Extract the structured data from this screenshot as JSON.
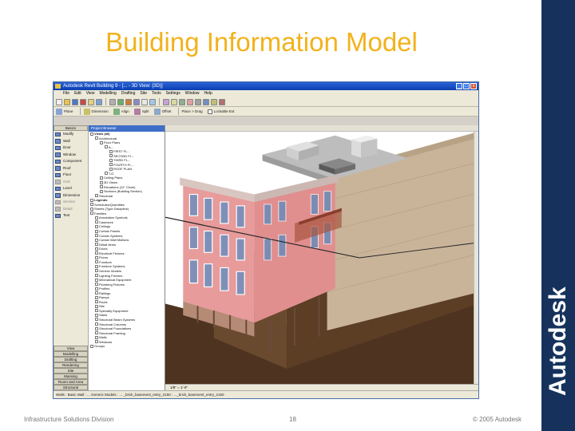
{
  "slide": {
    "title": "Building Information Model",
    "brand": "Autodesk",
    "footer_left": "Infrastructure Solutions Division",
    "footer_center": "18",
    "footer_right": "© 2005 Autodesk"
  },
  "window": {
    "title": "Autodesk Revit Building 9 - [... - 3D View: {3D}]",
    "min_label": "_",
    "max_label": "□",
    "close_label": "x"
  },
  "menu": [
    "File",
    "Edit",
    "View",
    "Modelling",
    "Drafting",
    "Site",
    "Tools",
    "Settings",
    "Window",
    "Help"
  ],
  "toolbar2": {
    "plane_label": "Plane",
    "dimension_label": "Dimension",
    "align_label": "Align",
    "split_label": "Split",
    "offset_label": "Offset",
    "place_label": "Place > Drag",
    "lockable_label": "Lockable Ext"
  },
  "design_bar": {
    "top_tab": "Basics",
    "items": [
      "Modify",
      "Wall",
      "Door",
      "Window",
      "Component",
      "Roof",
      "Floor",
      "Grid",
      "Level",
      "Dimension",
      "Section",
      "Detail",
      "Text"
    ],
    "dim_items": [
      false,
      false,
      false,
      false,
      false,
      false,
      false,
      true,
      false,
      false,
      true,
      true,
      false
    ],
    "bottom_tabs": [
      "View",
      "Modelling",
      "Drafting",
      "Rendering",
      "Site",
      "Massing",
      "Room and Area",
      "Structural"
    ]
  },
  "browser": {
    "title": "Project Browser",
    "items": [
      {
        "t": "Views (all)",
        "d": 0,
        "b": true
      },
      {
        "t": "Architectural",
        "d": 1
      },
      {
        "t": "Floor Plans",
        "d": 2
      },
      {
        "t": "A...",
        "d": 3
      },
      {
        "t": "FIRST FL...",
        "d": 4
      },
      {
        "t": "SECOND FL...",
        "d": 4
      },
      {
        "t": "THIRD FL...",
        "d": 4
      },
      {
        "t": "FOURTH FL...",
        "d": 4
      },
      {
        "t": "ROOF PLAN",
        "d": 4
      },
      {
        "t": "T.O.",
        "d": 3
      },
      {
        "t": "Ceiling Plans",
        "d": 2
      },
      {
        "t": "3D Views",
        "d": 2
      },
      {
        "t": "Elevations (12\" Circle)",
        "d": 2
      },
      {
        "t": "Sections (Building Section)",
        "d": 2
      },
      {
        "t": "Structural",
        "d": 1
      },
      {
        "t": "Legends",
        "d": 0,
        "b": true
      },
      {
        "t": "Schedules/Quantities",
        "d": 0
      },
      {
        "t": "Sheets (Type Discipline)",
        "d": 0
      },
      {
        "t": "Families",
        "d": 0
      },
      {
        "t": "Annotation Symbols",
        "d": 1
      },
      {
        "t": "Casework",
        "d": 1
      },
      {
        "t": "Ceilings",
        "d": 1
      },
      {
        "t": "Curtain Panels",
        "d": 1
      },
      {
        "t": "Curtain Systems",
        "d": 1
      },
      {
        "t": "Curtain Wall Mullions",
        "d": 1
      },
      {
        "t": "Detail Items",
        "d": 1
      },
      {
        "t": "Doors",
        "d": 1
      },
      {
        "t": "Electrical Fixtures",
        "d": 1
      },
      {
        "t": "Floors",
        "d": 1
      },
      {
        "t": "Furniture",
        "d": 1
      },
      {
        "t": "Furniture Systems",
        "d": 1
      },
      {
        "t": "Generic Models",
        "d": 1
      },
      {
        "t": "Lighting Fixtures",
        "d": 1
      },
      {
        "t": "Mechanical Equipment",
        "d": 1
      },
      {
        "t": "Plumbing Fixtures",
        "d": 1
      },
      {
        "t": "Profiles",
        "d": 1
      },
      {
        "t": "Railings",
        "d": 1
      },
      {
        "t": "Ramps",
        "d": 1
      },
      {
        "t": "Roofs",
        "d": 1
      },
      {
        "t": "Site",
        "d": 1
      },
      {
        "t": "Specialty Equipment",
        "d": 1
      },
      {
        "t": "Stairs",
        "d": 1
      },
      {
        "t": "Structural Beam Systems",
        "d": 1
      },
      {
        "t": "Structural Columns",
        "d": 1
      },
      {
        "t": "Structural Foundations",
        "d": 1
      },
      {
        "t": "Structural Framing",
        "d": 1
      },
      {
        "t": "Walls",
        "d": 1
      },
      {
        "t": "Windows",
        "d": 1
      },
      {
        "t": "Groups",
        "d": 0
      }
    ]
  },
  "view": {
    "scale_label": "1/8\" = 1'-0\""
  },
  "status": {
    "text": "Walls : Basic Wall : ... Generic Models : ... _brick_basement_entry_2150 : ..._brick_basement_entry_2150"
  },
  "colors": {
    "title": "#f2b21b",
    "brand_bar": "#16325c",
    "brick": "#e89a9a",
    "ground": "#5a3a22"
  }
}
